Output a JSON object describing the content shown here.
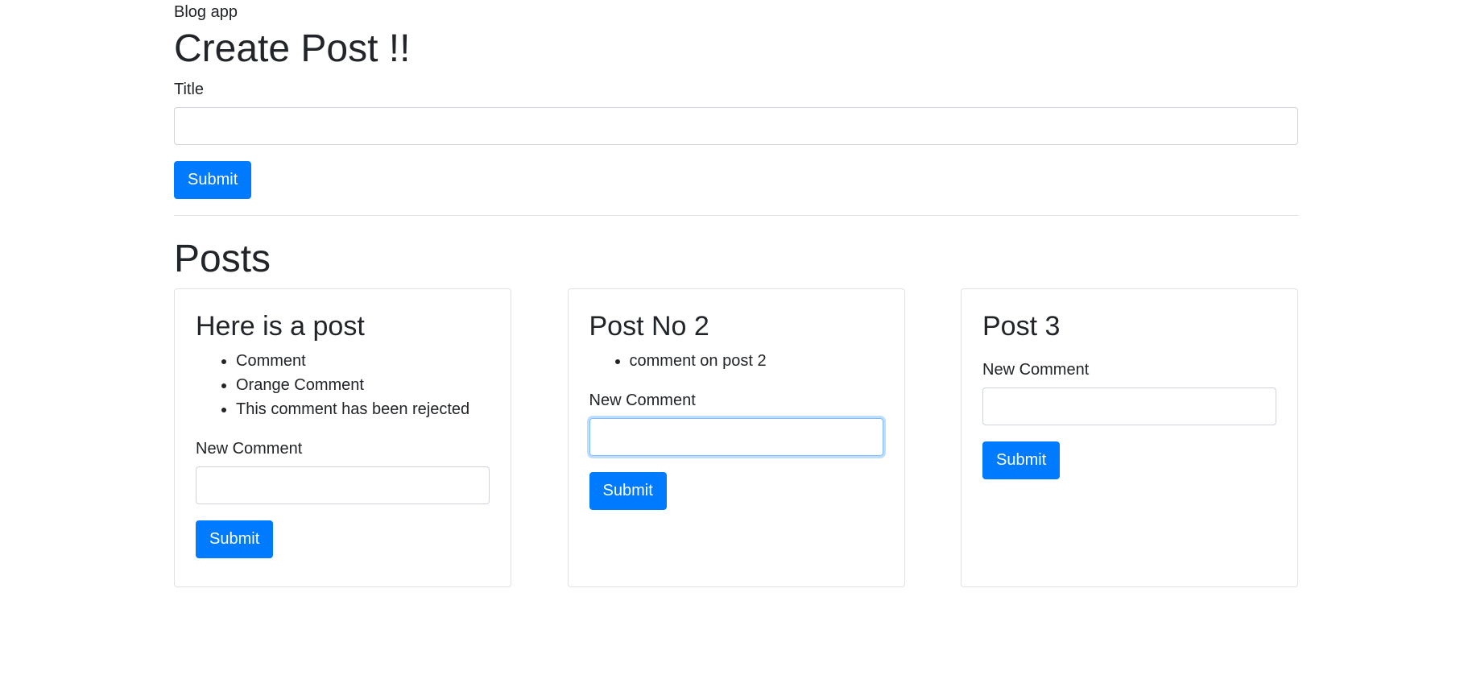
{
  "app": {
    "name": "Blog app"
  },
  "create_post": {
    "title": "Create Post !!",
    "field_label": "Title",
    "field_value": "",
    "submit_label": "Submit"
  },
  "posts_section": {
    "title": "Posts"
  },
  "posts": [
    {
      "title": "Here is a post",
      "comments": [
        "Comment",
        "Orange Comment",
        "This comment has been rejected"
      ],
      "new_comment_label": "New Comment",
      "new_comment_value": "",
      "submit_label": "Submit"
    },
    {
      "title": "Post No 2",
      "comments": [
        "comment on post 2"
      ],
      "new_comment_label": "New Comment",
      "new_comment_value": "",
      "submit_label": "Submit"
    },
    {
      "title": "Post 3",
      "comments": [],
      "new_comment_label": "New Comment",
      "new_comment_value": "",
      "submit_label": "Submit"
    }
  ],
  "colors": {
    "primary": "#007bff",
    "text": "#212529",
    "border": "#ced4da"
  }
}
